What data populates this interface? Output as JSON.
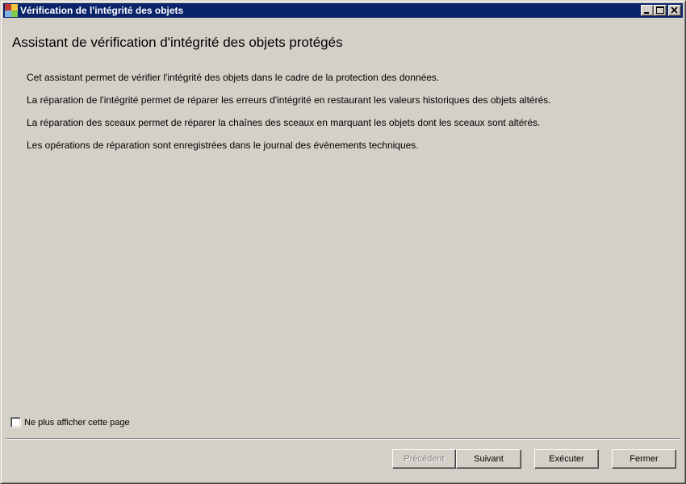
{
  "window": {
    "title": "Vérification de l'intégrité des objets",
    "icon": "app-icon",
    "controls": [
      "minimize-icon",
      "maximize-icon",
      "close-icon"
    ]
  },
  "main": {
    "heading": "Assistant de vérification d'intégrité des objets protégés",
    "paragraphs": [
      "Cet assistant permet de vérifier l'intégrité des objets dans le cadre de la protection des données.",
      "La réparation de l'intégrité permet de réparer les erreurs d'intégrité en restaurant les valeurs historiques des objets altérés.",
      "La réparation des sceaux permet de réparer la chaînes des sceaux en marquant les objets dont les sceaux sont altérés.",
      "Les opérations de réparation sont enregistrées dans le journal des évènements techniques."
    ]
  },
  "footer": {
    "checkbox_label": "Ne plus afficher cette page",
    "checkbox_checked": false,
    "buttons": {
      "previous": "Précédent",
      "next": "Suivant",
      "execute": "Exécuter",
      "close": "Fermer"
    }
  },
  "colors": {
    "titlebar": "#0a246a",
    "face": "#d4d0c8"
  }
}
